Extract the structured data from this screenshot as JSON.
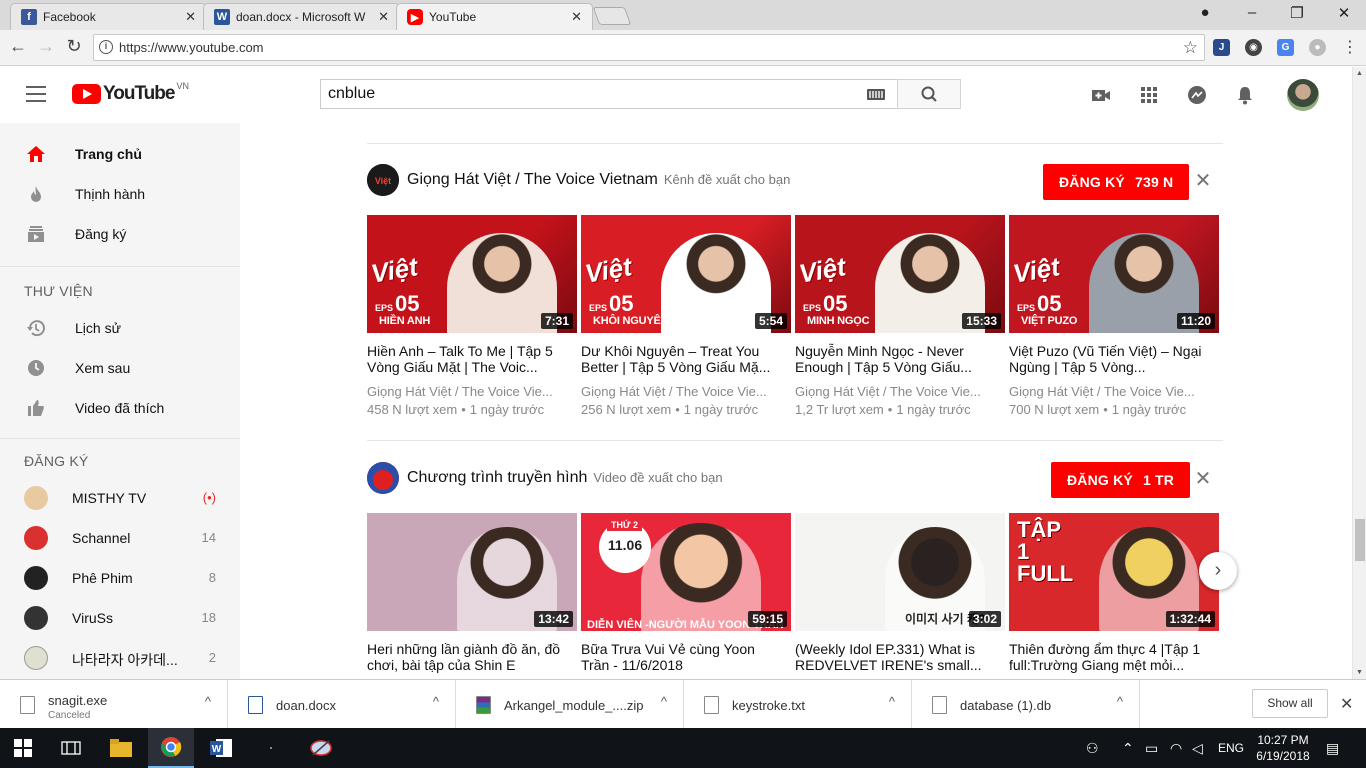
{
  "browser": {
    "tabs": [
      {
        "title": "Facebook",
        "icon": "facebook-icon",
        "color": "#3b5998"
      },
      {
        "title": "doan.docx - Microsoft W",
        "icon": "word-icon",
        "color": "#2b579a"
      },
      {
        "title": "YouTube",
        "icon": "youtube-icon",
        "color": "#ff0000"
      }
    ],
    "url": "https://www.youtube.com"
  },
  "youtube": {
    "logo_text": "YouTube",
    "country_code": "VN",
    "search_value": "cnblue"
  },
  "sidebar": {
    "main": [
      {
        "label": "Trang chủ",
        "icon": "home-icon"
      },
      {
        "label": "Thịnh hành",
        "icon": "trending-fire-icon"
      },
      {
        "label": "Đăng ký",
        "icon": "subscriptions-icon"
      }
    ],
    "library_heading": "THƯ VIỆN",
    "library": [
      {
        "label": "Lịch sử",
        "icon": "history-icon"
      },
      {
        "label": "Xem sau",
        "icon": "watch-later-icon"
      },
      {
        "label": "Video đã thích",
        "icon": "thumbs-up-icon"
      }
    ],
    "subs_heading": "ĐĂNG KÝ",
    "subscriptions": [
      {
        "name": "MISTHY TV",
        "count": "(•)",
        "color": "#e8c9a0"
      },
      {
        "name": "Schannel",
        "count": "14",
        "color": "#d93030"
      },
      {
        "name": "Phê Phim",
        "count": "8",
        "color": "#222222"
      },
      {
        "name": "ViruSs",
        "count": "18",
        "color": "#333333"
      },
      {
        "name": "나타라자 아카데...",
        "count": "2",
        "color": "#e0e0d0"
      }
    ]
  },
  "shelves": [
    {
      "channel": "Giọng Hát Việt / The Voice Vietnam",
      "note": "Kênh đề xuất cho bạn",
      "subscribe_label": "ĐĂNG KÝ",
      "subscriber_count": "739 N",
      "videos": [
        {
          "title": "Hiền Anh – Talk To Me | Tập 5 Vòng Giấu Mặt | The Voic...",
          "channel": "Giọng Hát Việt / The Voice Vie...",
          "views": "458 N lượt xem",
          "age": "1 ngày trước",
          "duration": "7:31",
          "badge": "Việt",
          "eps": "05",
          "eps_label": "EPS",
          "tname": "HIỀN ANH",
          "bg": "#c4121b",
          "figure": "#f0e0d8"
        },
        {
          "title": "Dư Khôi Nguyên – Treat You Better | Tập 5 Vòng Giấu Mặ...",
          "channel": "Giọng Hát Việt / The Voice Vie...",
          "views": "256 N lượt xem",
          "age": "1 ngày trước",
          "duration": "5:54",
          "badge": "Việt",
          "eps": "05",
          "eps_label": "EPS",
          "tname": "KHÔI NGUYÊN",
          "bg": "#d81e24",
          "figure": "#ffffff"
        },
        {
          "title": "Nguyễn Minh Ngọc - Never Enough | Tập 5 Vòng Giấu...",
          "channel": "Giọng Hát Việt / The Voice Vie...",
          "views": "1,2 Tr lượt xem",
          "age": "1 ngày trước",
          "duration": "15:33",
          "badge": "Việt",
          "eps": "05",
          "eps_label": "EPS",
          "tname": "MINH NGỌC",
          "bg": "#b8141c",
          "figure": "#f4eee8"
        },
        {
          "title": "Việt Puzo (Vũ Tiến Việt) – Ngại Ngùng | Tập 5 Vòng...",
          "channel": "Giọng Hát Việt / The Voice Vie...",
          "views": "700 N lượt xem",
          "age": "1 ngày trước",
          "duration": "11:20",
          "badge": "Việt",
          "eps": "05",
          "eps_label": "EPS",
          "tname": "VIỆT PUZO",
          "bg": "#c01620",
          "figure": "#9aa0aa"
        }
      ]
    },
    {
      "channel": "Chương trình truyền hình",
      "note": "Video đề xuất cho bạn",
      "subscribe_label": "ĐĂNG KÝ",
      "subscriber_count": "1 TR",
      "videos": [
        {
          "title": "Heri những lần giành đồ ăn, đồ chơi, bài tập của Shin E",
          "duration": "13:42",
          "bg": "#c9a7b8",
          "figure": "#e6d7dd",
          "caption": ""
        },
        {
          "title": "Bữa Trưa Vui Vẻ cùng Yoon Trần - 11/6/2018",
          "duration": "59:15",
          "bg": "#e8283a",
          "figure": "#f3c7a5",
          "caption": "DIỄN VIÊN -NGƯỜI MẪU YOON TRẦN",
          "date_tag": "THỨ 2",
          "date": "11.06"
        },
        {
          "title": "(Weekly Idol EP.331) What is REDVELVET IRENE's small...",
          "duration": "3:02",
          "bg": "#f4f4f2",
          "figure": "#2a2220",
          "caption": "이미지 사기 캐?"
        },
        {
          "title": "Thiên đường ẩm thực 4 |Tập 1 full:Trường Giang mệt mỏi...",
          "duration": "1:32:44",
          "bg": "#d8282c",
          "figure": "#f0d060",
          "caption": "TẬP 1 FULL"
        }
      ]
    }
  ],
  "downloads": [
    {
      "name": "snagit.exe",
      "status": "Canceled"
    },
    {
      "name": "doan.docx",
      "status": ""
    },
    {
      "name": "Arkangel_module_....zip",
      "status": ""
    },
    {
      "name": "keystroke.txt",
      "status": ""
    },
    {
      "name": "database (1).db",
      "status": ""
    }
  ],
  "downloads_show_all": "Show all",
  "taskbar": {
    "language": "ENG",
    "time": "10:27 PM",
    "date": "6/19/2018"
  }
}
